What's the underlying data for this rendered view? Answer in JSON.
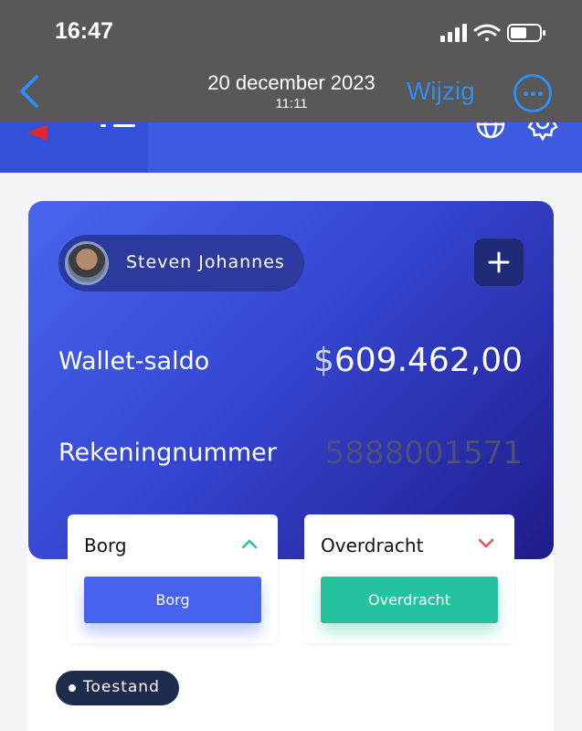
{
  "status_bar": {
    "time": "16:47"
  },
  "photo_nav": {
    "date": "20 december 2023",
    "time": "11:11",
    "edit_label": "Wijzig"
  },
  "wallet": {
    "user_name": "Steven Johannes",
    "balance_label": "Wallet-saldo",
    "balance_currency": "$",
    "balance_amount": "609.462,00",
    "account_label": "Rekeningnummer",
    "account_number": "5888001571"
  },
  "actions": {
    "deposit": {
      "title": "Borg",
      "button": "Borg"
    },
    "transfer": {
      "title": "Overdracht",
      "button": "Overdracht"
    }
  },
  "status_chip": {
    "label": "Toestand"
  },
  "colors": {
    "primary": "#3d5bdf",
    "deposit_button": "#4762ec",
    "transfer_button": "#25c2a0",
    "ios_link": "#2f8df6",
    "logo_red": "#e3262c"
  },
  "icons": [
    "back-chevron-icon",
    "more-icon",
    "signal-icon",
    "wifi-icon",
    "battery-icon",
    "globe-icon",
    "gear-icon",
    "menu-icon",
    "plus-icon",
    "chevron-up-icon",
    "chevron-down-icon"
  ]
}
